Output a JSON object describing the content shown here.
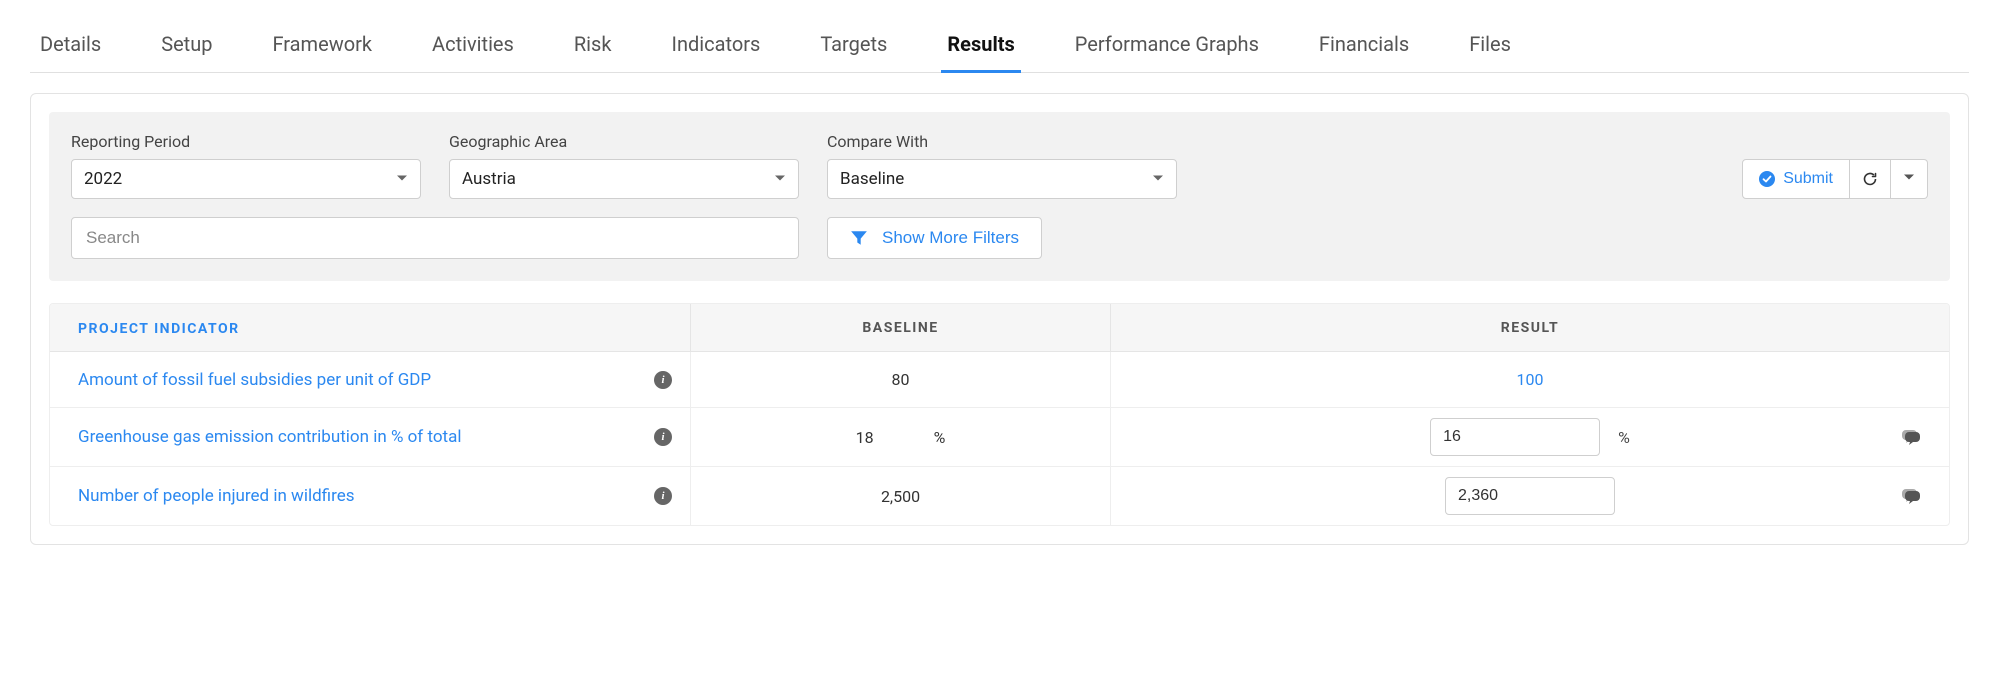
{
  "tabs": [
    {
      "label": "Details"
    },
    {
      "label": "Setup"
    },
    {
      "label": "Framework"
    },
    {
      "label": "Activities"
    },
    {
      "label": "Risk"
    },
    {
      "label": "Indicators"
    },
    {
      "label": "Targets"
    },
    {
      "label": "Results",
      "active": true
    },
    {
      "label": "Performance Graphs"
    },
    {
      "label": "Financials"
    },
    {
      "label": "Files"
    }
  ],
  "filters": {
    "reporting_period": {
      "label": "Reporting Period",
      "value": "2022"
    },
    "geographic_area": {
      "label": "Geographic Area",
      "value": "Austria"
    },
    "compare_with": {
      "label": "Compare With",
      "value": "Baseline"
    },
    "search_placeholder": "Search",
    "show_more_label": "Show More Filters"
  },
  "actions": {
    "submit_label": "Submit"
  },
  "table": {
    "headers": {
      "indicator": "PROJECT INDICATOR",
      "baseline": "BASELINE",
      "result": "RESULT"
    },
    "rows": [
      {
        "indicator": "Amount of fossil fuel subsidies per unit of GDP",
        "baseline_value": "80",
        "baseline_unit": "",
        "result_type": "link",
        "result_value": "100",
        "result_unit": "",
        "has_comments": false
      },
      {
        "indicator": "Greenhouse gas emission contribution in % of total",
        "baseline_value": "18",
        "baseline_unit": "%",
        "result_type": "input",
        "result_value": "16",
        "result_unit": "%",
        "has_comments": true
      },
      {
        "indicator": "Number of people injured in wildfires",
        "baseline_value": "2,500",
        "baseline_unit": "",
        "result_type": "input",
        "result_value": "2,360",
        "result_unit": "",
        "has_comments": true
      }
    ]
  }
}
